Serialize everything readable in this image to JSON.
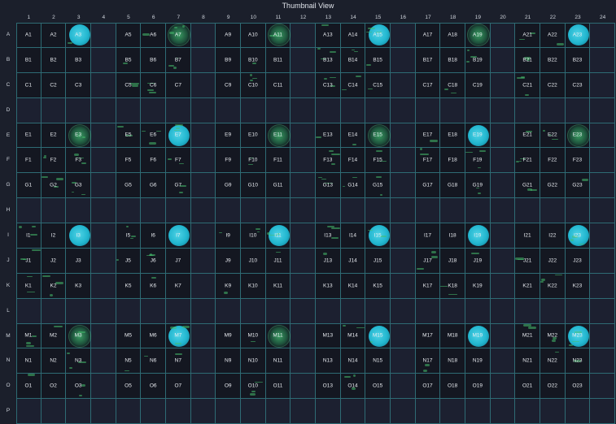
{
  "title": "Thumbnail View",
  "columns": [
    "1",
    "2",
    "3",
    "4",
    "5",
    "6",
    "7",
    "8",
    "9",
    "10",
    "11",
    "12",
    "13",
    "14",
    "15",
    "16",
    "17",
    "18",
    "19",
    "20",
    "21",
    "22",
    "23",
    "24"
  ],
  "rows": [
    "A",
    "B",
    "C",
    "D",
    "E",
    "F",
    "G",
    "H",
    "I",
    "J",
    "K",
    "L",
    "M",
    "N",
    "O",
    "P"
  ],
  "empty_rows": [
    "D",
    "H",
    "L",
    "P"
  ],
  "empty_cols": [
    "4",
    "8",
    "12",
    "16",
    "20",
    "24"
  ],
  "highlight_cols": [
    "3",
    "7",
    "11",
    "15",
    "19",
    "23"
  ],
  "highlight_rows": [
    "A",
    "E",
    "I",
    "M"
  ],
  "wells": [
    {
      "row": "A",
      "labels": [
        "A1",
        "A2",
        "A3",
        "",
        "A5",
        "A6",
        "A7",
        "",
        "A9",
        "A10",
        "A11",
        "",
        "A13",
        "A14",
        "A15",
        "",
        "A17",
        "A18",
        "A19",
        "",
        "A21",
        "A22",
        "A23",
        ""
      ]
    },
    {
      "row": "B",
      "labels": [
        "B1",
        "B2",
        "B3",
        "",
        "B5",
        "B6",
        "B7",
        "",
        "B9",
        "B10",
        "B11",
        "",
        "B13",
        "B14",
        "B15",
        "",
        "B17",
        "B18",
        "B19",
        "",
        "B21",
        "B22",
        "B23",
        ""
      ]
    },
    {
      "row": "C",
      "labels": [
        "C1",
        "C2",
        "C3",
        "",
        "C5",
        "C6",
        "C7",
        "",
        "C9",
        "C10",
        "C11",
        "",
        "C13",
        "C14",
        "C15",
        "",
        "C17",
        "C18",
        "C19",
        "",
        "C21",
        "C22",
        "C23",
        ""
      ]
    },
    {
      "row": "D",
      "labels": [
        "",
        "",
        "",
        "",
        "",
        "",
        "",
        "",
        "",
        "",
        "",
        "",
        "",
        "",
        "",
        "",
        "",
        "",
        "",
        "",
        "",
        "",
        "",
        ""
      ]
    },
    {
      "row": "E",
      "labels": [
        "E1",
        "E2",
        "E3",
        "",
        "E5",
        "E6",
        "E7",
        "",
        "E9",
        "E10",
        "E11",
        "",
        "E13",
        "E14",
        "E15",
        "",
        "E17",
        "E18",
        "E19",
        "",
        "E21",
        "E22",
        "E23",
        ""
      ]
    },
    {
      "row": "F",
      "labels": [
        "F1",
        "F2",
        "F3",
        "",
        "F5",
        "F6",
        "F7",
        "",
        "F9",
        "F10",
        "F11",
        "",
        "F13",
        "F14",
        "F15",
        "",
        "F17",
        "F18",
        "F19",
        "",
        "F21",
        "F22",
        "F23",
        ""
      ]
    },
    {
      "row": "G",
      "labels": [
        "G1",
        "G2",
        "G3",
        "",
        "G5",
        "G6",
        "G7",
        "",
        "G9",
        "G10",
        "G11",
        "",
        "G13",
        "G14",
        "G15",
        "",
        "G17",
        "G18",
        "G19",
        "",
        "G21",
        "G22",
        "G23",
        ""
      ]
    },
    {
      "row": "H",
      "labels": [
        "",
        "",
        "",
        "",
        "",
        "",
        "",
        "",
        "",
        "",
        "",
        "",
        "",
        "",
        "",
        "",
        "",
        "",
        "",
        "",
        "",
        "",
        "",
        ""
      ]
    },
    {
      "row": "I",
      "labels": [
        "I1",
        "I2",
        "I3",
        "",
        "I5",
        "I6",
        "I7",
        "",
        "I9",
        "I10",
        "I11",
        "",
        "I13",
        "I14",
        "I15",
        "",
        "I17",
        "I18",
        "I19",
        "",
        "I21",
        "I22",
        "I23",
        ""
      ]
    },
    {
      "row": "J",
      "labels": [
        "J1",
        "J2",
        "J3",
        "",
        "J5",
        "J6",
        "J7",
        "",
        "J9",
        "J10",
        "J11",
        "",
        "J13",
        "J14",
        "J15",
        "",
        "J17",
        "J18",
        "J19",
        "",
        "J21",
        "J22",
        "J23",
        ""
      ]
    },
    {
      "row": "K",
      "labels": [
        "K1",
        "K2",
        "K3",
        "",
        "K5",
        "K6",
        "K7",
        "",
        "K9",
        "K10",
        "K11",
        "",
        "K13",
        "K14",
        "K15",
        "",
        "K17",
        "K18",
        "K19",
        "",
        "K21",
        "K22",
        "K23",
        ""
      ]
    },
    {
      "row": "L",
      "labels": [
        "",
        "",
        "",
        "",
        "",
        "",
        "",
        "",
        "",
        "",
        "",
        "",
        "",
        "",
        "",
        "",
        "",
        "",
        "",
        "",
        "",
        "",
        "",
        ""
      ]
    },
    {
      "row": "M",
      "labels": [
        "M1",
        "M2",
        "M3",
        "",
        "M5",
        "M6",
        "M7",
        "",
        "M9",
        "M10",
        "M11",
        "",
        "M13",
        "M14",
        "M15",
        "",
        "M17",
        "M18",
        "M19",
        "",
        "M21",
        "M22",
        "M23",
        ""
      ]
    },
    {
      "row": "N",
      "labels": [
        "N1",
        "N2",
        "N3",
        "",
        "N5",
        "N6",
        "N7",
        "",
        "N9",
        "N10",
        "N11",
        "",
        "N13",
        "N14",
        "N15",
        "",
        "N17",
        "N18",
        "N19",
        "",
        "N21",
        "N22",
        "N23",
        ""
      ]
    },
    {
      "row": "O",
      "labels": [
        "O1",
        "O2",
        "O3",
        "",
        "O5",
        "O6",
        "O7",
        "",
        "O9",
        "O10",
        "O11",
        "",
        "O13",
        "O14",
        "O15",
        "",
        "O17",
        "O18",
        "O19",
        "",
        "O21",
        "O22",
        "O23",
        ""
      ]
    },
    {
      "row": "P",
      "labels": [
        "",
        "",
        "",
        "",
        "",
        "",
        "",
        "",
        "",
        "",
        "",
        "",
        "",
        "",
        "",
        "",
        "",
        "",
        "",
        "",
        "",
        "",
        "",
        ""
      ]
    }
  ],
  "cyan_wells": [
    "A3",
    "A15",
    "A23",
    "E7",
    "E19",
    "I3",
    "I7",
    "I11",
    "I15",
    "I19",
    "I23",
    "M7",
    "M15",
    "M19",
    "M23"
  ],
  "green_wells": [
    "A7",
    "A11",
    "A19",
    "E3",
    "E11",
    "E15",
    "E23",
    "M3",
    "M11"
  ],
  "colors": {
    "background": "#1b1f2b",
    "grid_line": "#2e6b74",
    "well_fill": "#141721",
    "signal_green": "#46c878",
    "signal_cyan": "#22b6cf"
  }
}
